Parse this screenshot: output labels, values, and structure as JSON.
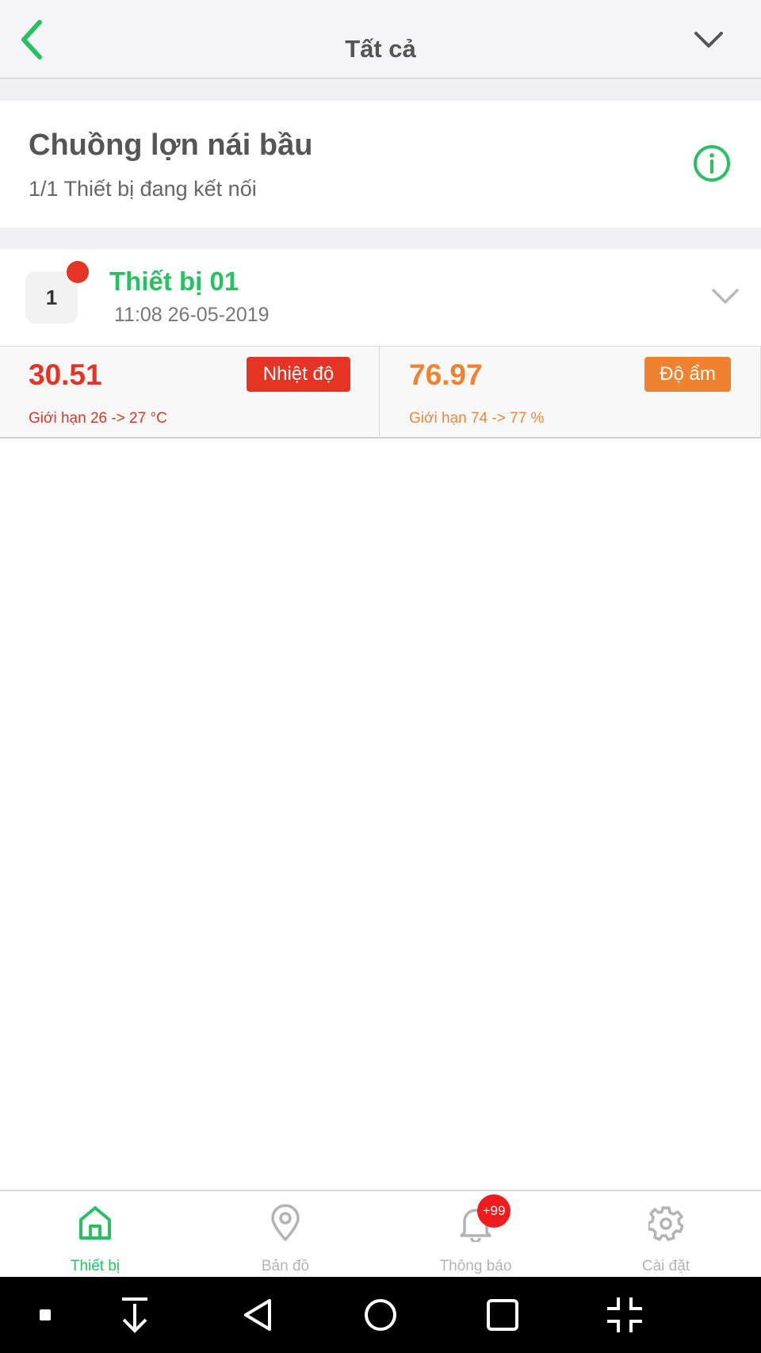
{
  "header": {
    "title": "Tất cả"
  },
  "group": {
    "title": "Chuồng lợn nái bầu",
    "subtitle": "1/1 Thiết bị đang kết nối"
  },
  "device": {
    "index": "1",
    "name": "Thiết bị 01",
    "timestamp": "11:08 26-05-2019",
    "status_color": "#e53324"
  },
  "sensors": [
    {
      "value": "30.51",
      "label": "Nhiệt độ",
      "limit": "Giới hạn 26 -> 27 °C",
      "color": "#e53324"
    },
    {
      "value": "76.97",
      "label": "Độ ẩm",
      "limit": "Giới hạn 74 -> 77 %",
      "color": "#f0822f"
    }
  ],
  "tabs": [
    {
      "label": "Thiết bị",
      "icon": "home-icon",
      "active": true
    },
    {
      "label": "Bản đồ",
      "icon": "map-pin-icon",
      "active": false
    },
    {
      "label": "Thông báo",
      "icon": "bell-icon",
      "active": false,
      "badge": "+99"
    },
    {
      "label": "Cài đặt",
      "icon": "gear-icon",
      "active": false
    }
  ],
  "colors": {
    "accent": "#27c164",
    "inactive": "#b3b3b3",
    "temperature": "#e53324",
    "humidity": "#f0822f"
  }
}
